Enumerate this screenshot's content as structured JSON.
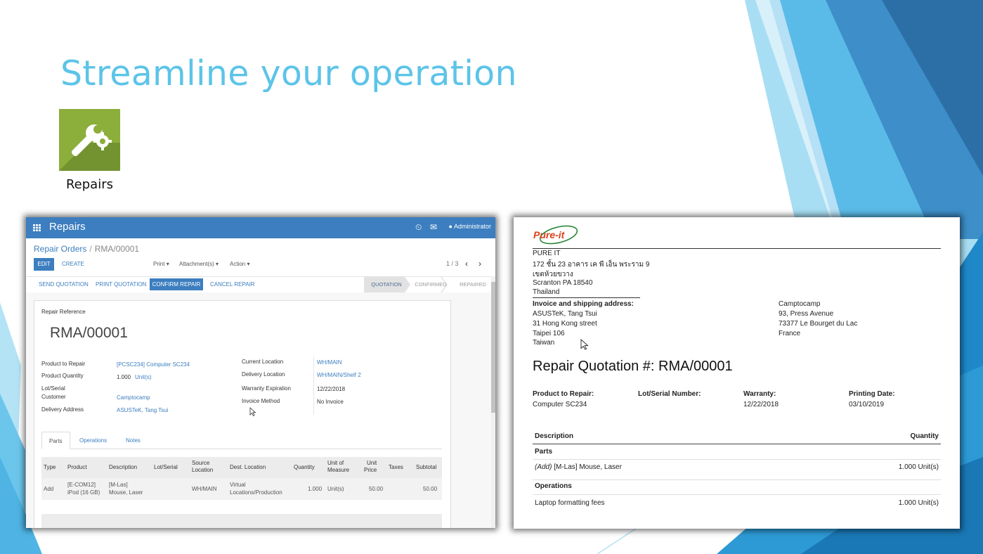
{
  "slide": {
    "title": "Streamline your operation",
    "app_label": "Repairs",
    "accent_color": "#5cc4e8",
    "app_icon_color": "#8cae3b",
    "app_icon": "wrench-gear-icon"
  },
  "odoo": {
    "app_title": "Repairs",
    "user": "Administrator",
    "breadcrumb_parent": "Repair Orders",
    "breadcrumb_current": "RMA/00001",
    "edit": "EDIT",
    "create": "CREATE",
    "print": "Print",
    "attachments": "Attachment(s)",
    "action": "Action",
    "pager": "1 / 3",
    "status_buttons": {
      "send": "SEND QUOTATION",
      "print": "PRINT QUOTATION",
      "confirm": "CONFIRM REPAIR",
      "cancel": "CANCEL REPAIR"
    },
    "stages": {
      "quotation": "QUOTATION",
      "confirmed": "CONFIRMED",
      "repaired": "REPAIRED"
    },
    "form": {
      "ref_label": "Repair Reference",
      "ref_value": "RMA/00001",
      "product_label": "Product to Repair",
      "product_value": "[PCSC234] Computer SC234",
      "qty_label": "Product Quantity",
      "qty_value": "1.000",
      "qty_uom": "Unit(s)",
      "lot_label": "Lot/Serial",
      "customer_label": "Customer",
      "customer_value": "Camptocamp",
      "delivery_address_label": "Delivery Address",
      "delivery_address_value": "ASUSTeK, Tang Tsui",
      "current_location_label": "Current Location",
      "current_location_value": "WH/MAIN",
      "delivery_location_label": "Delivery Location",
      "delivery_location_value": "WH/MAIN/Shelf 2",
      "warranty_label": "Warranty Expiration",
      "warranty_value": "12/22/2018",
      "invoice_method_label": "Invoice Method",
      "invoice_method_value": "No Invoice"
    },
    "tabs": {
      "parts": "Parts",
      "operations": "Operations",
      "notes": "Notes"
    },
    "table": {
      "headers": {
        "type": "Type",
        "product": "Product",
        "description": "Description",
        "lot": "Lot/Serial",
        "source_1": "Source",
        "source_2": "Location",
        "dest": "Dest. Location",
        "quantity": "Quantity",
        "uom_1": "Unit of",
        "uom_2": "Measure",
        "price_1": "Unit",
        "price_2": "Price",
        "taxes": "Taxes",
        "subtotal": "Subtotal"
      },
      "row": {
        "type": "Add",
        "product_1": "[E-COM12]",
        "product_2": "iPod (16 GB)",
        "description_1": "[M-Las]",
        "description_2": "Mouse, Laser",
        "source": "WH/MAIN",
        "dest_1": "Virtual",
        "dest_2": "Locations/Production",
        "quantity": "1.000",
        "uom": "Unit(s)",
        "price": "50.00",
        "subtotal": "50.00"
      }
    }
  },
  "quotation": {
    "logo": "Pure-it",
    "company": {
      "line1": "PURE IT",
      "line2": "172 ชั้น 23 อาคาร เค พี เอ็น พระราม 9",
      "line3": "เขตห้วยขวาง",
      "line4": "Scranton PA 18540",
      "line5": "Thailand"
    },
    "invoice_heading": "Invoice and shipping address:",
    "invoice": {
      "line1": "ASUSTeK, Tang Tsui",
      "line2": "31 Hong Kong street",
      "line3": "Taipei 106",
      "line4": "Taiwan"
    },
    "customer": {
      "line1": "Camptocamp",
      "line2": "93, Press Avenue",
      "line3": "73377 Le Bourget du Lac",
      "line4": "France"
    },
    "title": "Repair Quotation #: RMA/00001",
    "info": {
      "product_label": "Product to Repair:",
      "product_value": "Computer SC234",
      "lot_label": "Lot/Serial Number:",
      "warranty_label": "Warranty:",
      "warranty_value": "12/22/2018",
      "printing_label": "Printing Date:",
      "printing_value": "03/10/2019"
    },
    "table": {
      "description": "Description",
      "quantity": "Quantity",
      "parts": "Parts",
      "part_prefix": "(Add)",
      "part_name": "[M-Las] Mouse, Laser",
      "part_qty": "1.000 Unit(s)",
      "operations": "Operations",
      "op_name": "Laptop formatting fees",
      "op_qty": "1.000 Unit(s)"
    }
  }
}
